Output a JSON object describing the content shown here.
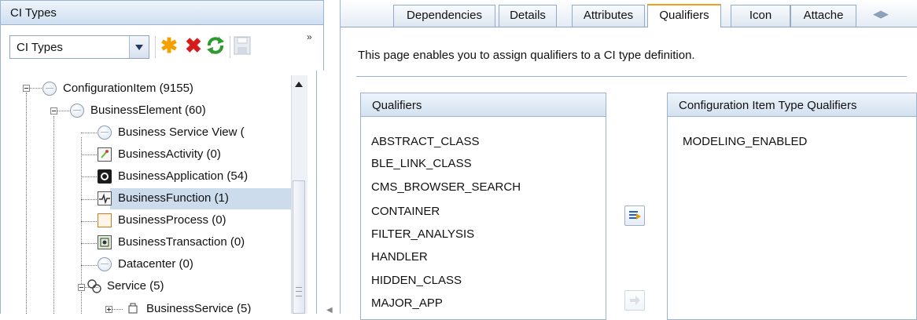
{
  "left_panel": {
    "title": "CI Types",
    "selector_value": "CI Types",
    "more_label": "»"
  },
  "tree": [
    {
      "label": "ConfigurationItem (9155)",
      "icon": "globe-icon"
    },
    {
      "label": "BusinessElement (60)",
      "icon": "globe-icon"
    },
    {
      "label": "Business Service View (",
      "icon": "globe-icon"
    },
    {
      "label": "BusinessActivity (0)",
      "icon": "activity-icon"
    },
    {
      "label": "BusinessApplication (54)",
      "icon": "application-icon"
    },
    {
      "label": "BusinessFunction (1)",
      "icon": "function-icon",
      "selected": true
    },
    {
      "label": "BusinessProcess (0)",
      "icon": "process-icon"
    },
    {
      "label": "BusinessTransaction (0)",
      "icon": "transaction-icon"
    },
    {
      "label": "Datacenter (0)",
      "icon": "globe-icon"
    },
    {
      "label": "Service (5)",
      "icon": "service-icon"
    },
    {
      "label": "BusinessService (5)",
      "icon": "business-service-icon"
    }
  ],
  "tabs": [
    "Dependencies",
    "Details",
    "Attributes",
    "Qualifiers",
    "Icon",
    "Attache"
  ],
  "active_tab": "Qualifiers",
  "intro": "This page enables you to assign qualifiers to a CI type definition.",
  "qualifiers": {
    "title": "Qualifiers",
    "items": [
      "ABSTRACT_CLASS",
      "BLE_LINK_CLASS",
      "CMS_BROWSER_SEARCH",
      "CONTAINER",
      "FILTER_ANALYSIS",
      "HANDLER",
      "HIDDEN_CLASS",
      "MAJOR_APP"
    ]
  },
  "assigned": {
    "title": "Configuration Item Type Qualifiers",
    "items": [
      "MODELING_ENABLED"
    ]
  },
  "colors": {
    "header_blue": "#cfdff0",
    "border_blue": "#9cb3cf",
    "selection": "#cddcec",
    "active_tab_accent": "#f0a020"
  }
}
